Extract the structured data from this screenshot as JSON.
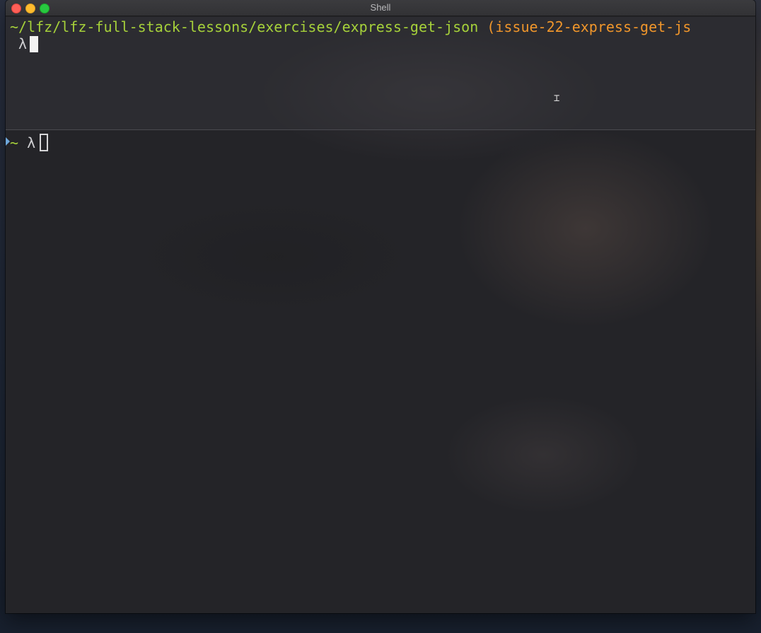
{
  "window": {
    "title": "Shell"
  },
  "pane_top": {
    "cwd": "~/lfz/lfz-full-stack-lessons/exercises/express-get-json",
    "branch": " (issue-22-express-get-js",
    "prompt_symbol": " λ"
  },
  "pane_bottom": {
    "tilde": "~",
    "prompt_symbol": " λ"
  },
  "icons": {
    "close": "close-traffic-light-icon",
    "minimize": "minimize-traffic-light-icon",
    "maximize": "maximize-traffic-light-icon",
    "pointer": "ibeam-cursor-icon",
    "active_pane": "active-pane-marker-icon"
  },
  "colors": {
    "path": "#a6d13a",
    "branch": "#f0962b",
    "text": "#cfcfd2",
    "close": "#fe5f57",
    "minimize": "#febc2e",
    "maximize": "#28c840"
  }
}
